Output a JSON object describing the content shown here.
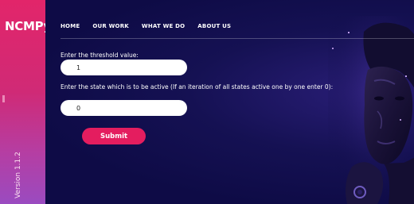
{
  "brand": "NCMPy",
  "version": "Version 1.1.2",
  "nav": [
    "HOME",
    "OUR WORK",
    "WHAT WE DO",
    "ABOUT US"
  ],
  "form": {
    "threshold_label": "Enter the threshold value:",
    "threshold_value": "1",
    "state_label": "Enter the state which is to be active (If an iteration of all states active one by one enter 0):",
    "state_value": "0",
    "submit_label": "Submit"
  },
  "colors": {
    "sidebar_top": "#e2256a",
    "sidebar_bottom": "#9a4bc0",
    "background": "#0e0b46",
    "button": "#e41d5f"
  }
}
